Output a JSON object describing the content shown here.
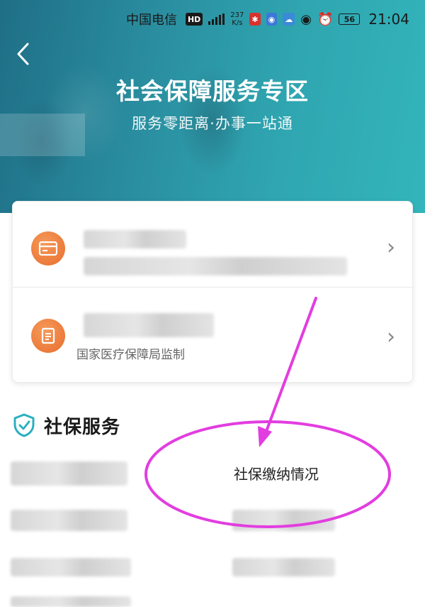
{
  "status_bar": {
    "carrier": "中国电信",
    "hd_badge": "HD",
    "network_speed_value": "237",
    "network_speed_unit": "K/s",
    "battery": "56",
    "time": "21:04"
  },
  "banner": {
    "title": "社会保障服务专区",
    "subtitle": "服务零距离·办事一站通"
  },
  "cards": [
    {
      "icon": "card-icon",
      "sub_text": ""
    },
    {
      "icon": "document-icon",
      "sub_text": "国家医疗保障局监制"
    }
  ],
  "section": {
    "icon": "shield-check-icon",
    "title": "社保服务"
  },
  "services": {
    "visible_item_label": "社保缴纳情况"
  },
  "colors": {
    "banner_start": "#1f6f86",
    "banner_end": "#33b5bb",
    "icon_orange": "#e86d2e",
    "shield_teal": "#2ab0c0",
    "annotation_magenta": "#e23de0"
  }
}
